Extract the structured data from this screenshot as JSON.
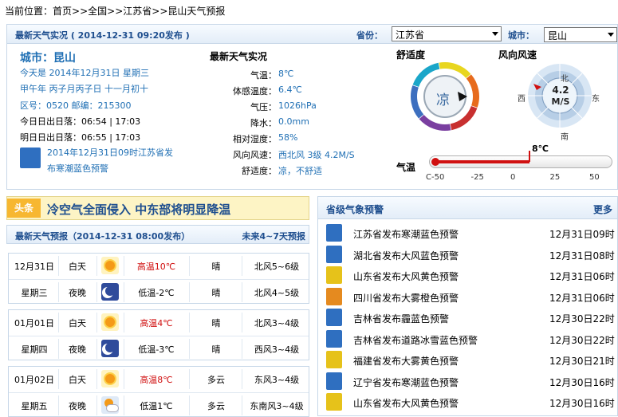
{
  "breadcrumb": {
    "prefix": "当前位置：",
    "items": [
      "首页",
      "全国",
      "江苏省",
      "昆山天气预报"
    ],
    "sep": ">>"
  },
  "live": {
    "header": "最新天气实况 ( 2014-12-31  09:20发布 )",
    "province_label": "省份：",
    "province": "江苏省",
    "city_label": "城市：",
    "city": "昆山",
    "city_title": "城市：昆山",
    "today": "今天是  2014年12月31日  星期三",
    "lunar": "甲午年  丙子月丙子日  十一月初十",
    "codes": "区号：0520   邮编：215300",
    "sun_today": "今日日出日落：06:54 | 17:03",
    "sun_tomorrow": "明日日出日落：06:55 | 17:03",
    "alert_text": "2014年12月31日09时江苏省发布寒潮蓝色预警",
    "alert_line1": "2014年12月31日09时江苏省发",
    "alert_line2": "布寒潮蓝色预警",
    "realtime_title": "最新天气实况",
    "rows": [
      {
        "label": "气温：",
        "value": "8℃"
      },
      {
        "label": "体感温度：",
        "value": "6.4℃"
      },
      {
        "label": "气压：",
        "value": "1026hPa"
      },
      {
        "label": "降水：",
        "value": "0.0mm"
      },
      {
        "label": "相对湿度：",
        "value": "58%"
      },
      {
        "label": "风向风速：",
        "value": "西北风 3级 4.2M/S"
      },
      {
        "label": "舒适度：",
        "value": "凉，不舒适"
      }
    ],
    "comfort_title": "舒适度",
    "comfort_value": "凉",
    "wind_title": "风向风速",
    "wind_value": "4.2",
    "wind_unit": "M/S",
    "compass": {
      "n": "北",
      "s": "南",
      "e": "东",
      "w": "西"
    },
    "temp_label": "气温",
    "temp_value": "8℃",
    "temp_c": 8,
    "temp_ticks": [
      "C",
      "-50",
      "-25",
      "0",
      "25",
      "50"
    ]
  },
  "news": {
    "tag": "头条",
    "headline": "冷空气全面侵入  中东部将明显降温"
  },
  "forecast": {
    "header": "最新天气预报（2014-12-31  08:00发布）",
    "more": "未来4~7天预报",
    "days": [
      {
        "date": "12月31日",
        "weekday": "星期三",
        "day": {
          "period": "白天",
          "icon": "sun-icon",
          "temp": "高温10℃",
          "weather": "晴",
          "wind": "北风5~6级"
        },
        "night": {
          "period": "夜晚",
          "icon": "moon-icon",
          "temp": "低温-2℃",
          "weather": "晴",
          "wind": "北风4~5级"
        }
      },
      {
        "date": "01月01日",
        "weekday": "星期四",
        "day": {
          "period": "白天",
          "icon": "sun-icon",
          "temp": "高温4℃",
          "weather": "晴",
          "wind": "北风3~4级"
        },
        "night": {
          "period": "夜晚",
          "icon": "moon-icon",
          "temp": "低温-3℃",
          "weather": "晴",
          "wind": "西风3~4级"
        }
      },
      {
        "date": "01月02日",
        "weekday": "星期五",
        "day": {
          "period": "白天",
          "icon": "sun-icon",
          "temp": "高温8℃",
          "weather": "多云",
          "wind": "东风3~4级"
        },
        "night": {
          "period": "夜晚",
          "icon": "cloud-sun-icon",
          "temp": "低温1℃",
          "weather": "多云",
          "wind": "东南风3~4级"
        }
      }
    ]
  },
  "warnings": {
    "title": "省级气象预警",
    "more": "更多",
    "items": [
      {
        "text": "江苏省发布寒潮蓝色预警",
        "time": "12月31日09时",
        "color": "#2f6fc0"
      },
      {
        "text": "湖北省发布大风蓝色预警",
        "time": "12月31日08时",
        "color": "#2f6fc0"
      },
      {
        "text": "山东省发布大风黄色预警",
        "time": "12月31日06时",
        "color": "#e6c21a"
      },
      {
        "text": "四川省发布大雾橙色预警",
        "time": "12月31日06时",
        "color": "#e58a1f"
      },
      {
        "text": "吉林省发布霾蓝色预警",
        "time": "12月30日22时",
        "color": "#2f6fc0"
      },
      {
        "text": "吉林省发布道路冰雪蓝色预警",
        "time": "12月30日22时",
        "color": "#2f6fc0"
      },
      {
        "text": "福建省发布大雾黄色预警",
        "time": "12月30日21时",
        "color": "#e6c21a"
      },
      {
        "text": "辽宁省发布寒潮蓝色预警",
        "time": "12月30日16时",
        "color": "#2f6fc0"
      },
      {
        "text": "山东省发布大风黄色预警",
        "time": "12月30日16时",
        "color": "#e6c21a"
      }
    ]
  }
}
